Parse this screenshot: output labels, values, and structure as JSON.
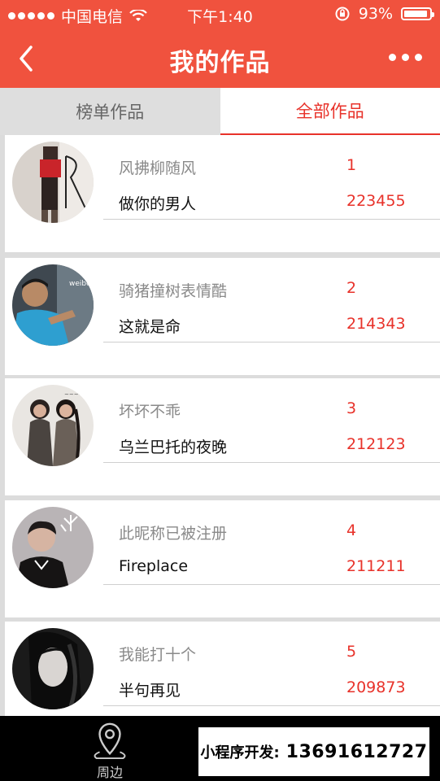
{
  "status_bar": {
    "carrier": "中国电信",
    "time": "下午1:40",
    "battery_text": "93%",
    "battery_level": 0.93
  },
  "header": {
    "title": "我的作品",
    "back_icon": "chevron-left-icon",
    "more_icon": "more-dots-icon"
  },
  "tabs": [
    {
      "label": "榜单作品",
      "active": false
    },
    {
      "label": "全部作品",
      "active": true
    }
  ],
  "items": [
    {
      "nickname": "风拂柳随风",
      "rank": "1",
      "song": "做你的男人",
      "score": "223455"
    },
    {
      "nickname": "骑猪撞树表情酷",
      "rank": "2",
      "song": "这就是命",
      "score": "214343"
    },
    {
      "nickname": "坏坏不乖",
      "rank": "3",
      "song": "乌兰巴托的夜晚",
      "score": "212123"
    },
    {
      "nickname": "此昵称已被注册",
      "rank": "4",
      "song": "Fireplace",
      "score": "211211"
    },
    {
      "nickname": "我能打十个",
      "rank": "5",
      "song": "半句再见",
      "score": "209873"
    }
  ],
  "bottom_nav": [
    {
      "label": "周边",
      "icon": "location-pin-icon"
    }
  ],
  "promo": {
    "label": "小程序开发:",
    "phone": "13691612727"
  },
  "colors": {
    "brand_red": "#f0523e",
    "accent_red": "#e8322a",
    "tab_inactive_bg": "#dedede",
    "list_bg": "#dcdcdc"
  }
}
